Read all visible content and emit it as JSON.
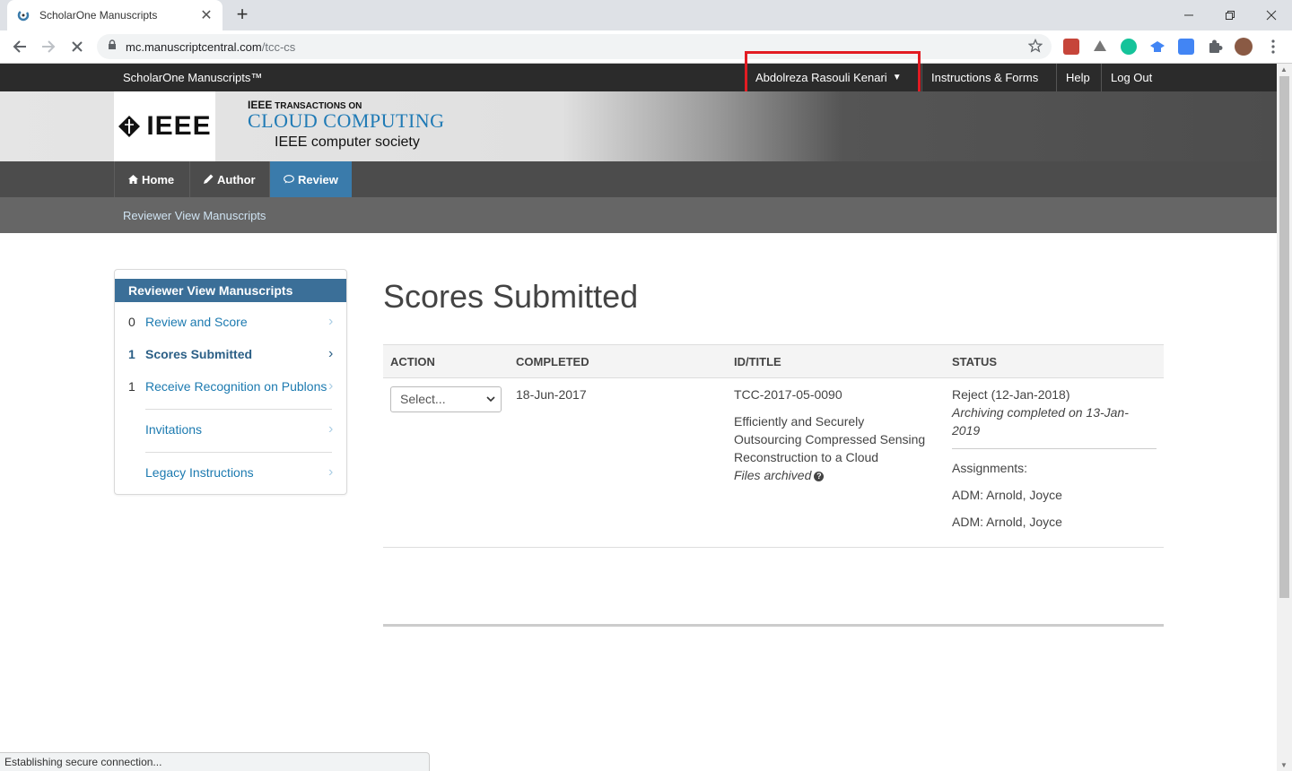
{
  "browser": {
    "tab_title": "ScholarOne Manuscripts",
    "tab_close": "✕",
    "new_tab": "+",
    "url_domain": "mc.manuscriptcentral.com",
    "url_path": "/tcc-cs",
    "status_text": "Establishing secure connection..."
  },
  "header": {
    "brand": "ScholarOne Manuscripts™",
    "user_name": "Abdolreza Rasouli Kenari",
    "links": [
      "Instructions & Forms",
      "Help",
      "Log Out"
    ]
  },
  "banner": {
    "logo_text": "IEEE",
    "journal_line1_bold": "IEEE",
    "journal_line1": " TRANSACTIONS ON",
    "journal_line2": "CLOUD COMPUTING",
    "journal_line3": "IEEE  computer society"
  },
  "mainnav": {
    "items": [
      {
        "label": "Home",
        "icon": "home-icon"
      },
      {
        "label": "Author",
        "icon": "pencil-icon"
      },
      {
        "label": "Review",
        "icon": "comment-icon"
      }
    ]
  },
  "subnav": {
    "breadcrumb": "Reviewer View Manuscripts"
  },
  "sidebar": {
    "title": "Reviewer View Manuscripts",
    "items": [
      {
        "count": "0",
        "label": "Review and Score"
      },
      {
        "count": "1",
        "label": "Scores Submitted"
      },
      {
        "count": "1",
        "label": "Receive Recognition on Publons"
      },
      {
        "count": "",
        "label": "Invitations"
      },
      {
        "count": "",
        "label": "Legacy Instructions"
      }
    ]
  },
  "main": {
    "title": "Scores Submitted",
    "columns": [
      "ACTION",
      "COMPLETED",
      "ID/TITLE",
      "STATUS"
    ],
    "rows": [
      {
        "action_select": "Select...",
        "completed": "18-Jun-2017",
        "id": "TCC-2017-05-0090",
        "title_lines": [
          "Efficiently and Securely",
          "Outsourcing Compressed Sensing",
          "Reconstruction to a Cloud"
        ],
        "files_note": "Files archived",
        "status": "Reject (12-Jan-2018)",
        "archive_lines": [
          "Archiving completed on 13-Jan-",
          "2019"
        ],
        "assignments_label": "Assignments:",
        "assignments": [
          "ADM: Arnold, Joyce",
          "ADM: Arnold, Joyce"
        ]
      }
    ]
  },
  "colors": {
    "accent_blue": "#3a7bab",
    "link_blue": "#1c7ab0",
    "highlight_red": "#e21c23",
    "journal_blue": "#1f7ab5"
  }
}
